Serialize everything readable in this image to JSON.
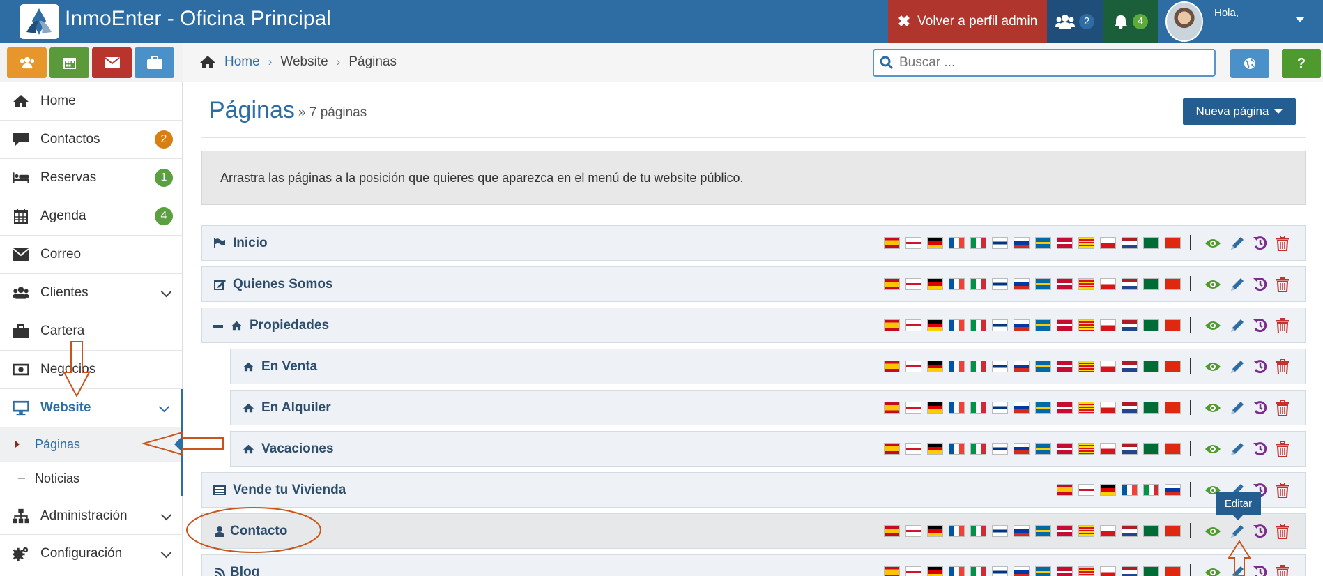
{
  "header": {
    "brand": "InmoEnter - Oficina Principal",
    "back_button": "Volver a perfil admin",
    "users_count": "2",
    "notifications_count": "4",
    "greeting": "Hola,"
  },
  "breadcrumb": {
    "home": "Home",
    "section": "Website",
    "current": "Páginas"
  },
  "search": {
    "placeholder": "Buscar ..."
  },
  "help_label": "?",
  "sidebar": {
    "home": "Home",
    "contactos": {
      "label": "Contactos",
      "badge": "2"
    },
    "reservas": {
      "label": "Reservas",
      "badge": "1"
    },
    "agenda": {
      "label": "Agenda",
      "badge": "4"
    },
    "correo": "Correo",
    "clientes": "Clientes",
    "cartera": "Cartera",
    "negocios": "Negocios",
    "website": "Website",
    "paginas": "Páginas",
    "noticias": "Noticias",
    "administracion": "Administración",
    "configuracion": "Configuración"
  },
  "main": {
    "title": "Páginas",
    "subtitle": "» 7 páginas",
    "new_button": "Nueva página",
    "info": "Arrastra las páginas a la posición que quieres que aparezca en el menú de tu website público."
  },
  "pages": [
    {
      "label": "Inicio",
      "icon": "flag-icon"
    },
    {
      "label": "Quienes Somos",
      "icon": "edit-icon"
    },
    {
      "label": "Propiedades",
      "icon": "home-icon"
    },
    {
      "label": "En Venta",
      "icon": "home-icon"
    },
    {
      "label": "En Alquiler",
      "icon": "home-icon"
    },
    {
      "label": "Vacaciones",
      "icon": "home-icon"
    },
    {
      "label": "Vende tu Vivienda",
      "icon": "list-icon"
    },
    {
      "label": "Contacto",
      "icon": "user-icon"
    },
    {
      "label": "Blog",
      "icon": "rss-icon"
    }
  ],
  "tooltip": "Editar",
  "colors": {
    "header": "#2e6da4",
    "back_button": "#b0362d",
    "primary": "#2e6da4",
    "badge_orange": "#d97f12",
    "badge_green": "#5aa03e",
    "annotation": "#c8561c",
    "view_icon": "#4e9a2f",
    "edit_icon": "#2e6da4",
    "history_icon": "#7b2d8b",
    "delete_icon": "#c9302c"
  }
}
